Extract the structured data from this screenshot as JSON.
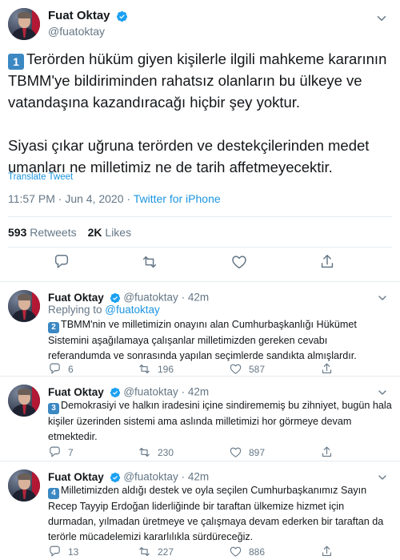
{
  "main_tweet": {
    "author_name": "Fuat Oktay",
    "author_handle": "@fuatoktay",
    "number_badge": "1",
    "paragraph1": "Terörden hüküm giyen kişilerle ilgili mahkeme kararının TBMM'ye bildiriminden rahatsız olanların bu ülkeye ve vatandaşına kazandıracağı hiçbir şey yoktur.",
    "paragraph2": "Siyasi çıkar uğruna terörden ve destekçilerinden medet umanları ne milletimiz ne de tarih affetmeyecektir.",
    "translate_label": "Translate Tweet",
    "timestamp": "11:57 PM · Jun 4, 2020",
    "separator": " · ",
    "source": "Twitter for iPhone",
    "retweets_count": "593",
    "retweets_label": "Retweets",
    "likes_count": "2K",
    "likes_label": "Likes"
  },
  "replies": [
    {
      "author_name": "Fuat Oktay",
      "author_handle": "@fuatoktay",
      "time": "· 42m",
      "replying_prefix": "Replying to ",
      "replying_to": "@fuatoktay",
      "number_badge": "2",
      "text": "TBMM'nin ve milletimizin onayını alan Cumhurbaşkanlığı Hükümet Sistemini aşağılamaya çalışanlar milletimizden gereken cevabı referandumda ve sonrasında yapılan seçimlerde sandıkta almışlardır.",
      "reply_count": "6",
      "retweet_count": "196",
      "like_count": "587"
    },
    {
      "author_name": "Fuat Oktay",
      "author_handle": "@fuatoktay",
      "time": "· 42m",
      "number_badge": "3",
      "text": "Demokrasiyi ve halkın iradesini içine sindirememiş bu zihniyet, bugün hala kişiler üzerinden sistemi ama aslında milletimizi hor görmeye devam etmektedir.",
      "reply_count": "7",
      "retweet_count": "230",
      "like_count": "897"
    },
    {
      "author_name": "Fuat Oktay",
      "author_handle": "@fuatoktay",
      "time": "· 42m",
      "number_badge": "4",
      "text": "Milletimizden aldığı destek ve oyla seçilen Cumhurbaşkanımız Sayın Recep Tayyip Erdoğan liderliğinde bir taraftan ülkemize hizmet için durmadan, yılmadan üretmeye ve çalışmaya devam ederken bir taraftan da terörle mücadelemizi kararlılıkla sürdüreceğiz.",
      "reply_count": "13",
      "retweet_count": "227",
      "like_count": "886"
    }
  ],
  "colors": {
    "accent": "#1b95e0",
    "verified": "#1da1f2",
    "muted_text": "#657786",
    "divider": "#e6ecf0",
    "keycap_blue": "#3b88c3"
  },
  "icons": [
    "verified-badge-icon",
    "chevron-down-icon",
    "reply-icon",
    "retweet-icon",
    "like-icon",
    "share-icon"
  ]
}
